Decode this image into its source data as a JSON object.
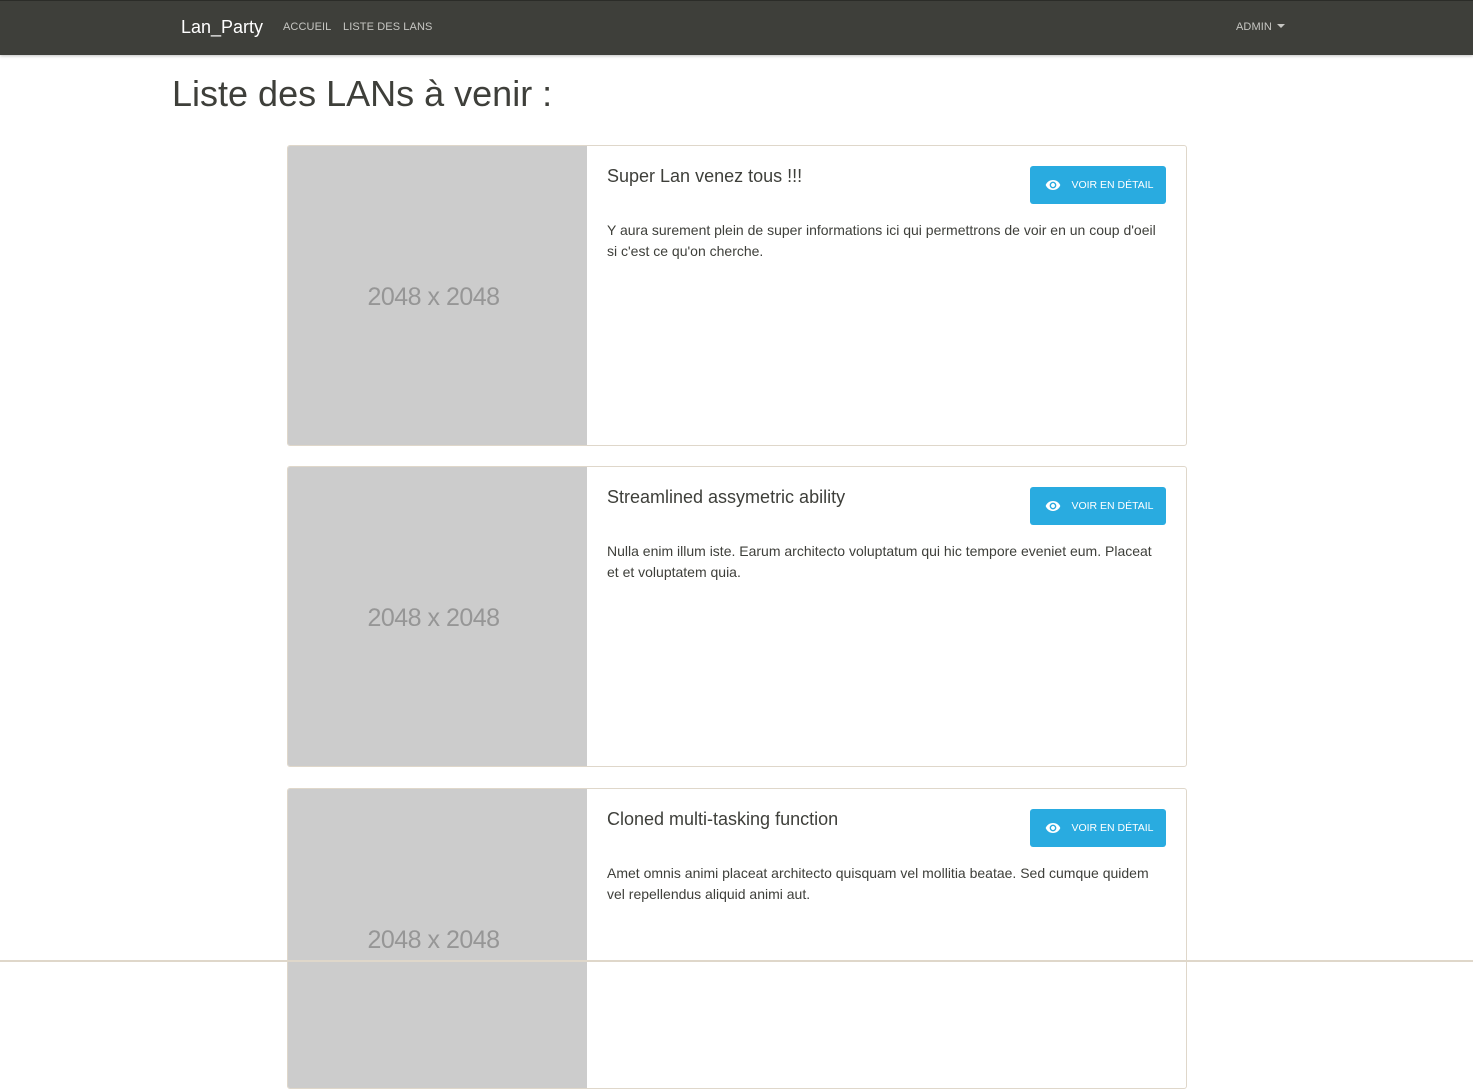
{
  "navbar": {
    "brand": "Lan_Party",
    "links": [
      "ACCUEIL",
      "LISTE DES LANS"
    ],
    "user_menu": "ADMIN"
  },
  "page": {
    "title": "Liste des LANs à venir :"
  },
  "lans": [
    {
      "image_placeholder": "2048 x 2048",
      "title": "Super Lan venez tous !!!",
      "description": "Y aura surement plein de super informations ici qui permettrons de voir en un coup d'oeil si c'est ce qu'on cherche.",
      "button_label": "VOIR EN DÉTAIL"
    },
    {
      "image_placeholder": "2048 x 2048",
      "title": "Streamlined assymetric ability",
      "description": "Nulla enim illum iste. Earum architecto voluptatum qui hic tempore eveniet eum. Placeat et et voluptatem quia.",
      "button_label": "VOIR EN DÉTAIL"
    },
    {
      "image_placeholder": "2048 x 2048",
      "title": "Cloned multi-tasking function",
      "description": "Amet omnis animi placeat architecto quisquam vel mollitia beatae. Sed cumque quidem vel repellendus aliquid animi aut.",
      "button_label": "VOIR EN DÉTAIL"
    }
  ],
  "colors": {
    "navbar": "#3e3f3a",
    "primary_button": "#29abe0",
    "image_placeholder": "#cccccc",
    "card_border": "#dfd7ca"
  },
  "icons": {
    "detail_button": "eye-icon",
    "user_menu": "chevron-down-icon"
  }
}
